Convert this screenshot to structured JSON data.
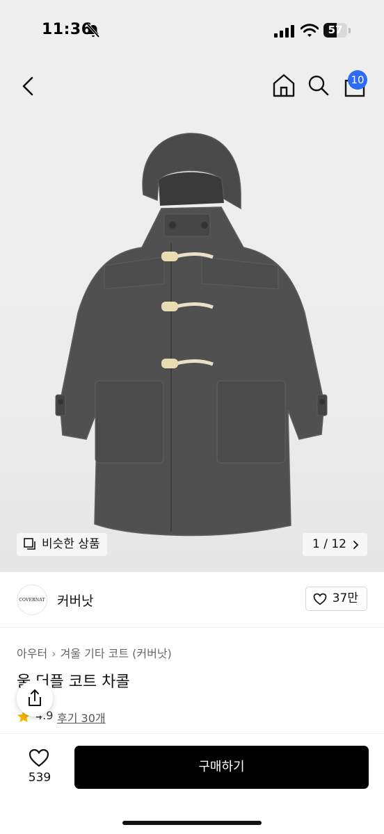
{
  "status_bar": {
    "time": "11:36",
    "battery": "57",
    "battery_level": 0.57,
    "icons": [
      "bell-slash-icon",
      "cellular-signal-icon",
      "wifi-icon",
      "battery-icon"
    ]
  },
  "nav": {
    "icons": [
      "chevron-left-icon",
      "home-icon",
      "search-icon",
      "shopping-bag-icon"
    ],
    "cart_badge": "10",
    "badge_color": "#2e6cf5"
  },
  "gallery": {
    "similar_label": "비슷한 상품",
    "page_indicator": "1 / 12"
  },
  "brand": {
    "logo_text": "COVERNAT",
    "name": "커버낫",
    "likes": "37만"
  },
  "product": {
    "breadcrumb": [
      "아우터",
      "겨울 기타 코트 (커버낫)"
    ],
    "title": "울 더플 코트 차콜",
    "rating": "4.9",
    "reviews": "후기 30개",
    "star_color": "#f5b400"
  },
  "bottom_bar": {
    "wish_count": "539",
    "buy_label": "구매하기",
    "buy_color": "#000000"
  }
}
